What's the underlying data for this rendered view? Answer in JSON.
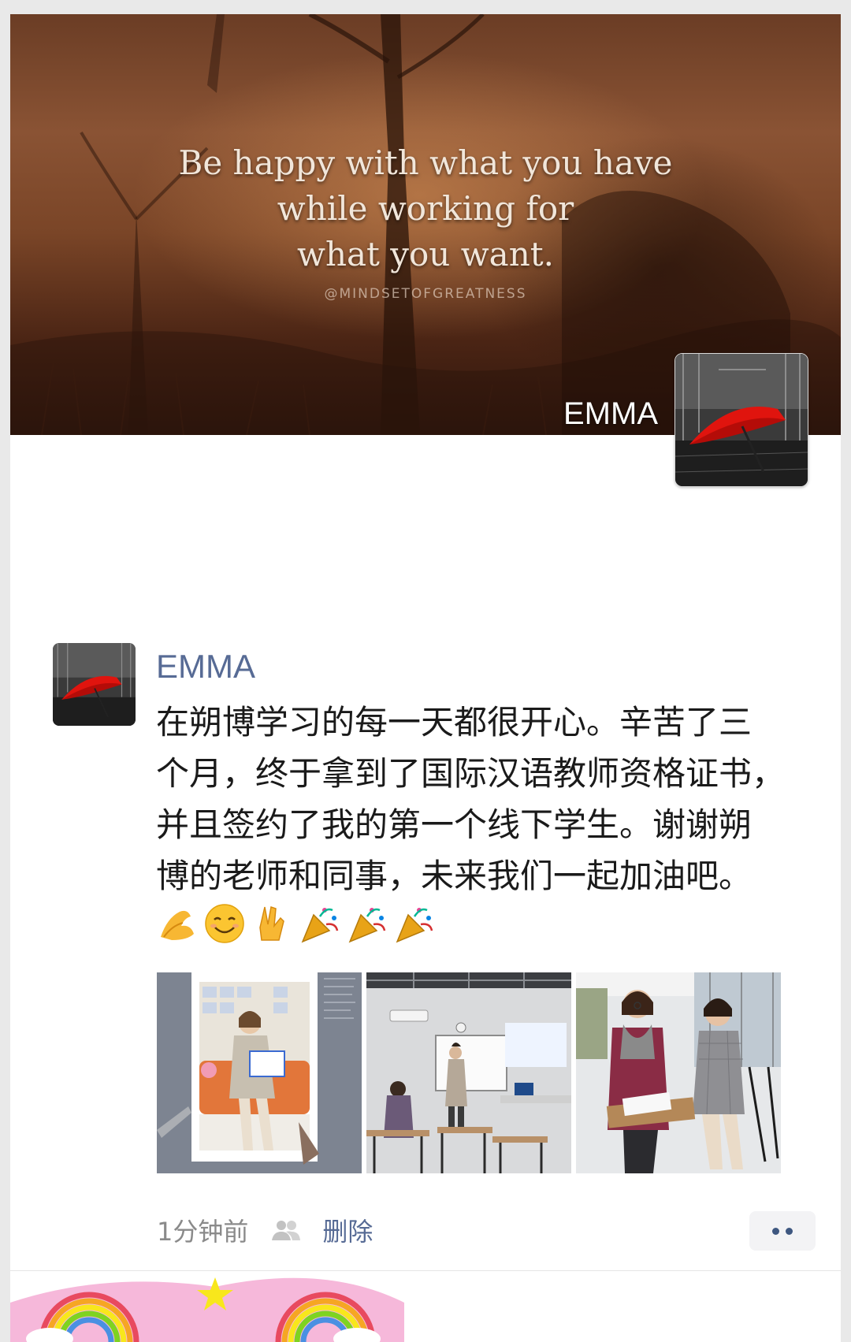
{
  "cover": {
    "quote_lines": [
      "Be happy with what you have",
      "while working for",
      "what you want."
    ],
    "quote_handle": "@MINDSETOFGREATNESS",
    "profile_name": "EMMA"
  },
  "post": {
    "author": "EMMA",
    "text_lines": [
      "在朔博学习的每一天都很开心。辛苦了三",
      "个月，终于拿到了国际汉语教师资格证书，",
      "并且签约了我的第一个线下学生。谢谢朔",
      "博的老师和同事，未来我们一起加油吧。"
    ],
    "emojis": [
      "ok-hand-emoji",
      "smiling-face-emoji",
      "victory-hand-emoji",
      "party-popper-emoji",
      "party-popper-emoji",
      "party-popper-emoji"
    ],
    "photos": [
      "photo-woman-on-orange-sofa",
      "photo-classroom-teaching",
      "photo-two-women-in-class"
    ],
    "time": "1分钟前",
    "delete_label": "删除"
  },
  "colors": {
    "name_link": "#576b95",
    "time_gray": "#8a8a8a"
  }
}
